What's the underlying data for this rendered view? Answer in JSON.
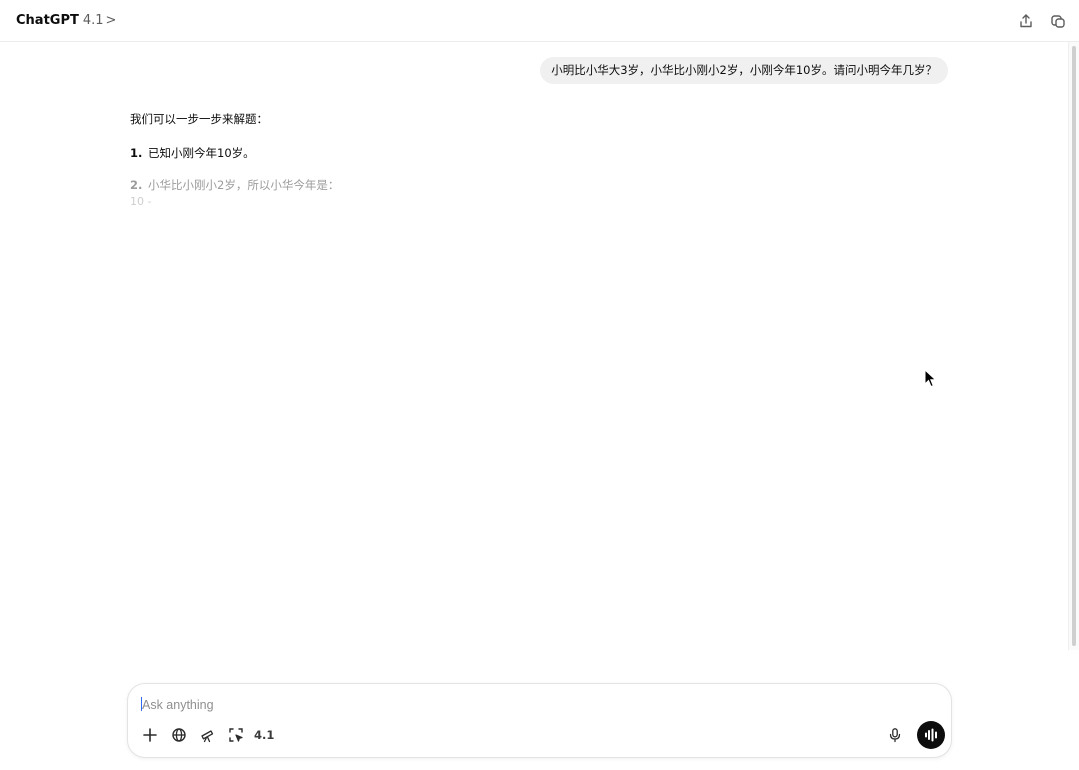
{
  "header": {
    "model_name": "ChatGPT",
    "model_version": "4.1",
    "chevron": ">",
    "share_icon": "share-icon",
    "new_chat_icon": "new-chat-icon"
  },
  "conversation": {
    "user_message": "小明比小华大3岁，小华比小刚小2岁，小刚今年10岁。请问小明今年几岁？",
    "assistant": {
      "intro": "我们可以一步一步来解题：",
      "steps": [
        {
          "num": "1.",
          "text": "已知小刚今年10岁。"
        },
        {
          "num": "2.",
          "text": "小华比小刚小2岁，所以小华今年是："
        }
      ],
      "partial_line": "10 -"
    }
  },
  "composer": {
    "placeholder": "Ask anything",
    "value": "",
    "model_label": "4.1",
    "tools": [
      "plus-icon",
      "globe-icon",
      "telescope-icon",
      "select-icon",
      "mic-icon",
      "voice-mode-icon"
    ]
  },
  "colors": {
    "bubble_bg": "#f0f0f0",
    "voice_btn_bg": "#0d0d0d",
    "placeholder": "#8f8f8f",
    "caret": "#2f6cf6"
  }
}
